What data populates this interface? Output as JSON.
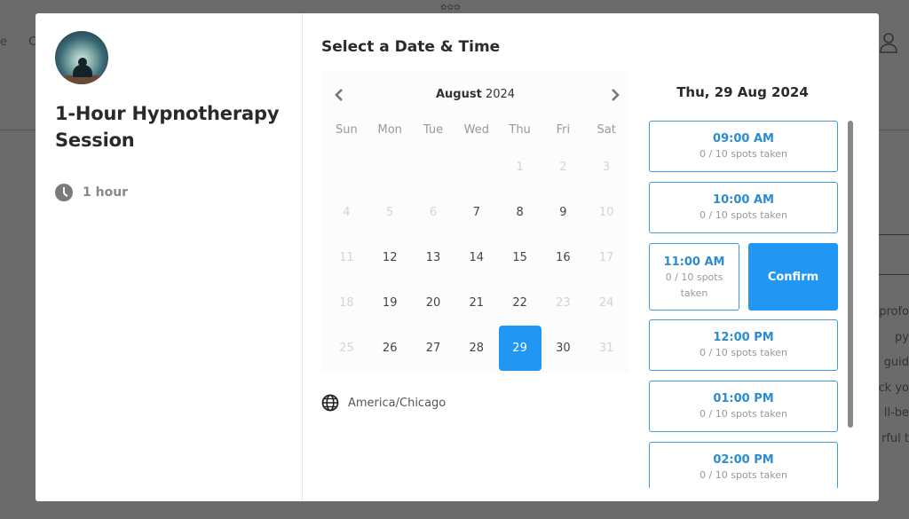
{
  "background": {
    "logo_text": "✿✿✿",
    "nav_items": [
      "e",
      "C"
    ],
    "text_fragments": [
      "profo",
      "py",
      "guid",
      "ck yo",
      "ll-be",
      "rful t"
    ]
  },
  "event": {
    "title": "1-Hour Hypnotherapy Session",
    "duration": "1 hour",
    "avatar_alt": "meditation figure"
  },
  "scheduler": {
    "title": "Select a Date & Time",
    "calendar": {
      "month": "August",
      "year": "2024",
      "weekdays": [
        "Sun",
        "Mon",
        "Tue",
        "Wed",
        "Thu",
        "Fri",
        "Sat"
      ],
      "leading_blanks": 4,
      "days": [
        {
          "d": "1",
          "state": "disabled"
        },
        {
          "d": "2",
          "state": "disabled"
        },
        {
          "d": "3",
          "state": "disabled"
        },
        {
          "d": "4",
          "state": "disabled"
        },
        {
          "d": "5",
          "state": "disabled"
        },
        {
          "d": "6",
          "state": "disabled"
        },
        {
          "d": "7",
          "state": "available"
        },
        {
          "d": "8",
          "state": "available"
        },
        {
          "d": "9",
          "state": "available"
        },
        {
          "d": "10",
          "state": "disabled"
        },
        {
          "d": "11",
          "state": "disabled"
        },
        {
          "d": "12",
          "state": "available"
        },
        {
          "d": "13",
          "state": "available"
        },
        {
          "d": "14",
          "state": "available"
        },
        {
          "d": "15",
          "state": "available"
        },
        {
          "d": "16",
          "state": "available"
        },
        {
          "d": "17",
          "state": "disabled"
        },
        {
          "d": "18",
          "state": "disabled"
        },
        {
          "d": "19",
          "state": "available"
        },
        {
          "d": "20",
          "state": "available"
        },
        {
          "d": "21",
          "state": "available"
        },
        {
          "d": "22",
          "state": "available"
        },
        {
          "d": "23",
          "state": "disabled"
        },
        {
          "d": "24",
          "state": "disabled"
        },
        {
          "d": "25",
          "state": "disabled"
        },
        {
          "d": "26",
          "state": "available"
        },
        {
          "d": "27",
          "state": "available"
        },
        {
          "d": "28",
          "state": "available"
        },
        {
          "d": "29",
          "state": "selected"
        },
        {
          "d": "30",
          "state": "available"
        },
        {
          "d": "31",
          "state": "disabled"
        }
      ]
    },
    "timezone": "America/Chicago",
    "selected_date_label": "Thu, 29 Aug 2024",
    "slots": [
      {
        "time": "09:00 AM",
        "spots": "0 / 10 spots taken"
      },
      {
        "time": "10:00 AM",
        "spots": "0 / 10 spots taken"
      },
      {
        "time": "11:00 AM",
        "spots": "0 / 10 spots taken",
        "selected": true
      },
      {
        "time": "12:00 PM",
        "spots": "0 / 10 spots taken"
      },
      {
        "time": "01:00 PM",
        "spots": "0 / 10 spots taken"
      },
      {
        "time": "02:00 PM",
        "spots": "0 / 10 spots taken"
      }
    ],
    "confirm_label": "Confirm"
  },
  "colors": {
    "accent": "#2196f3",
    "slot_border": "#3d9bd6",
    "slot_time": "#2b8ccf"
  }
}
